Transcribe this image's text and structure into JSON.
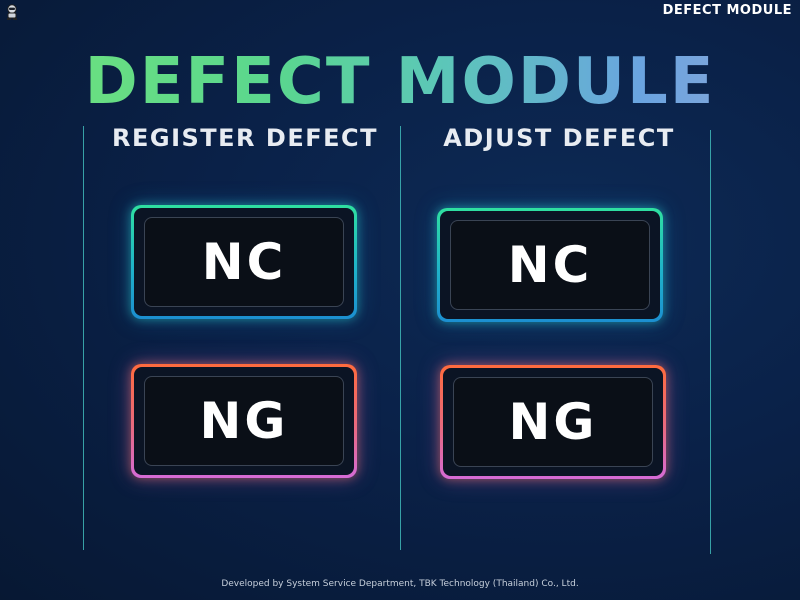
{
  "window": {
    "title": "DEFECT MODULE",
    "app_icon": "robot-icon"
  },
  "main": {
    "title": "DEFECT MODULE"
  },
  "sections": [
    {
      "title": "REGISTER DEFECT",
      "nc_label": "NC",
      "ng_label": "NG"
    },
    {
      "title": "ADJUST DEFECT",
      "nc_label": "NC",
      "ng_label": "NG"
    }
  ],
  "footer": {
    "text": "Developed by System Service Department, TBK Technology (Thailand) Co., Ltd."
  },
  "colors": {
    "background": "#0a2148",
    "nc_border_top": "#2fe0a0",
    "nc_border_bottom": "#1c8fd0",
    "ng_border_top": "#ff6b3d",
    "ng_border_bottom": "#d56bd6",
    "divider": "#3fb8b8"
  }
}
